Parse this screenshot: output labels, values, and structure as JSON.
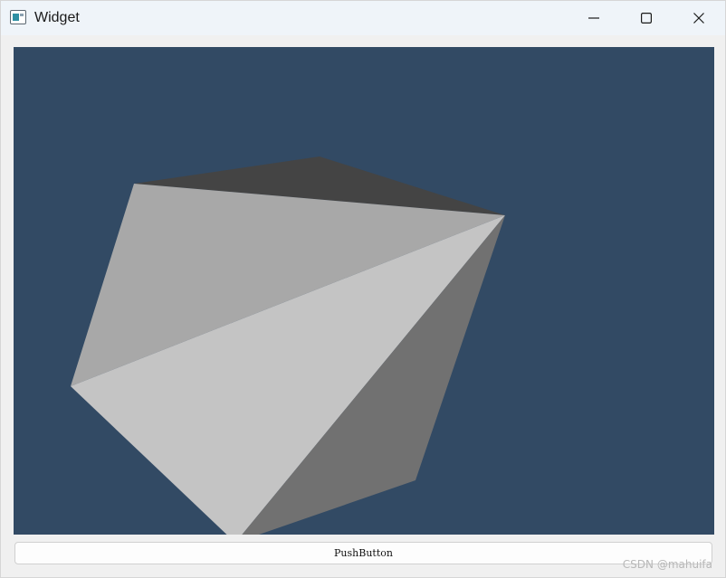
{
  "window": {
    "title": "Widget",
    "controls": {
      "minimize_icon": "minimize-icon",
      "maximize_icon": "maximize-icon",
      "close_icon": "close-icon"
    }
  },
  "viewport": {
    "background_color": "#324a64",
    "face_colors": [
      "#444444",
      "#a8a8a8",
      "#c4c4c4",
      "#717171"
    ]
  },
  "push_button": {
    "label": "PushButton"
  },
  "watermark": {
    "text": "CSDN @mahuifa"
  }
}
